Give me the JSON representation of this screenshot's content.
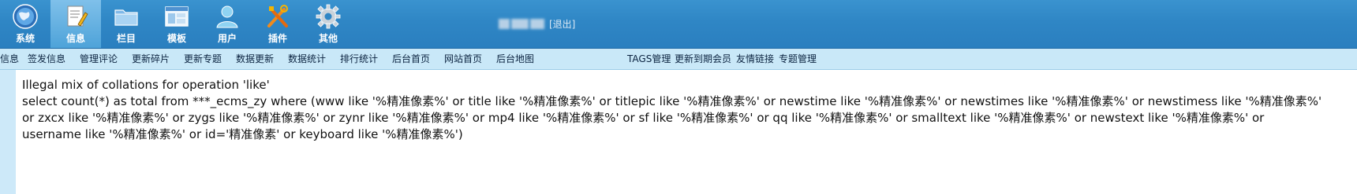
{
  "top_nav": {
    "items": [
      {
        "label": "系统",
        "icon": "globe-icon"
      },
      {
        "label": "信息",
        "icon": "edit-document-icon",
        "active": true
      },
      {
        "label": "栏目",
        "icon": "folder-icon"
      },
      {
        "label": "模板",
        "icon": "window-template-icon"
      },
      {
        "label": "用户",
        "icon": "user-icon"
      },
      {
        "label": "插件",
        "icon": "tools-icon"
      },
      {
        "label": "其他",
        "icon": "gear-icon"
      }
    ],
    "status_text": "[退出]"
  },
  "sub_nav": {
    "items": [
      "信息",
      "签发信息",
      "管理评论",
      "更新碎片",
      "更新专题",
      "数据更新",
      "数据统计",
      "排行统计",
      "后台首页",
      "网站首页",
      "后台地图",
      "TAGS管理",
      "更新到期会员",
      "友情链接",
      "专题管理"
    ]
  },
  "error": {
    "title": "Illegal mix of collations for operation 'like'",
    "sql_lines": [
      "select count(*) as total from ***_ecms_zy where (www like '%精准像素%' or title like '%精准像素%' or titlepic like '%精准像素%' or newstime like '%精准像素%' or newstimes like '%精准像素%' or newstimess like '%精准像素%'",
      "or zxcx like '%精准像素%' or zygs like '%精准像素%' or zynr like '%精准像素%' or mp4 like '%精准像素%' or sf like '%精准像素%' or qq like '%精准像素%' or smalltext like '%精准像素%' or newstext like '%精准像素%' or",
      "username like '%精准像素%' or id='精准像素' or keyboard like '%精准像素%')"
    ]
  },
  "colors": {
    "topbar": "#2f86c5",
    "active_tab": "#6bb6e6",
    "subbar": "#c9e8f8"
  }
}
